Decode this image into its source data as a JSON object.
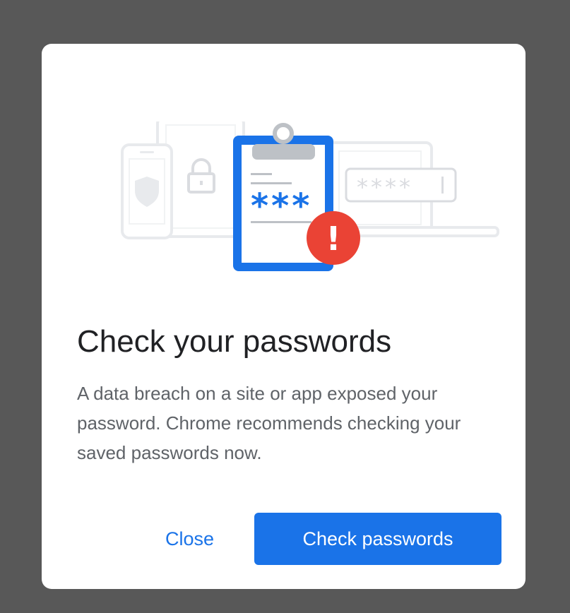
{
  "dialog": {
    "title": "Check your passwords",
    "body": "A data breach on a site or app exposed your password. Chrome recommends checking your saved passwords now.",
    "close_label": "Close",
    "check_label": "Check passwords"
  },
  "illustration": {
    "clipboard_stars": "***",
    "password_field_stars": "****",
    "alert_mark": "!"
  },
  "colors": {
    "backdrop": "#585858",
    "dialog_bg": "#ffffff",
    "accent_blue": "#1a73e8",
    "alert_red": "#ea4335",
    "title_text": "#202124",
    "body_text": "#5f6368"
  },
  "icons": [
    "phone-icon",
    "shield-icon",
    "tablet-icon",
    "lock-icon",
    "clipboard-icon",
    "laptop-icon",
    "password-field-icon",
    "alert-icon"
  ]
}
